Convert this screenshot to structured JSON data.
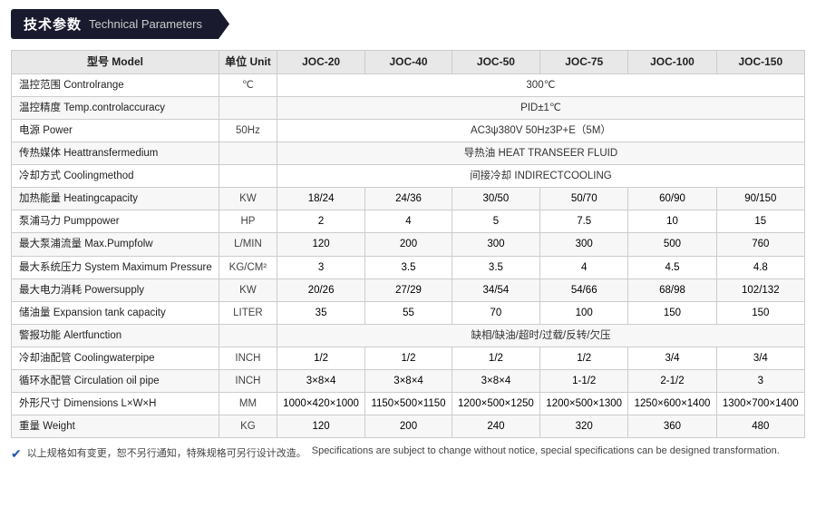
{
  "header": {
    "cn_title": "技术参数",
    "en_title": "Technical Parameters"
  },
  "table": {
    "columns": [
      "型号 Model",
      "单位 Unit",
      "JOC-20",
      "JOC-40",
      "JOC-50",
      "JOC-75",
      "JOC-100",
      "JOC-150"
    ],
    "rows": [
      {
        "label": "温控范围 Controlrange",
        "unit": "℃",
        "values": [
          "300℃",
          null,
          null,
          null,
          null,
          null
        ],
        "span": 6
      },
      {
        "label": "温控精度 Temp.controlaccuracy",
        "unit": "",
        "values": [
          "PID±1℃",
          null,
          null,
          null,
          null,
          null
        ],
        "span": 6
      },
      {
        "label": "电源 Power",
        "unit": "50Hz",
        "values": [
          "AC3ψ380V 50Hz3P+E（5M）",
          null,
          null,
          null,
          null,
          null
        ],
        "span": 6
      },
      {
        "label": "传热媒体 Heattransfermedium",
        "unit": "",
        "values": [
          "导热油 HEAT TRANSEER FLUID",
          null,
          null,
          null,
          null,
          null
        ],
        "span": 6
      },
      {
        "label": "冷却方式 Coolingmethod",
        "unit": "",
        "values": [
          "间接冷却 INDIRECTCOOLING",
          null,
          null,
          null,
          null,
          null
        ],
        "span": 6
      },
      {
        "label": "加热能量 Heatingcapacity",
        "unit": "KW",
        "values": [
          "18/24",
          "24/36",
          "30/50",
          "50/70",
          "60/90",
          "90/150"
        ],
        "span": null
      },
      {
        "label": "泵浦马力 Pumppower",
        "unit": "HP",
        "values": [
          "2",
          "4",
          "5",
          "7.5",
          "10",
          "15"
        ],
        "span": null
      },
      {
        "label": "最大泵浦流量 Max.Pumpfolw",
        "unit": "L/MIN",
        "values": [
          "120",
          "200",
          "300",
          "300",
          "500",
          "760"
        ],
        "span": null
      },
      {
        "label": "最大系统压力 System Maximum Pressure",
        "unit": "KG/CM²",
        "values": [
          "3",
          "3.5",
          "3.5",
          "4",
          "4.5",
          "4.8"
        ],
        "span": null
      },
      {
        "label": "最大电力消耗 Powersupply",
        "unit": "KW",
        "values": [
          "20/26",
          "27/29",
          "34/54",
          "54/66",
          "68/98",
          "102/132"
        ],
        "span": null
      },
      {
        "label": "储油量 Expansion tank capacity",
        "unit": "LITER",
        "values": [
          "35",
          "55",
          "70",
          "100",
          "150",
          "150"
        ],
        "span": null
      },
      {
        "label": "警报功能 Alertfunction",
        "unit": "",
        "values": [
          "缺相/缺油/超时/过载/反转/欠压",
          null,
          null,
          null,
          null,
          null
        ],
        "span": 6
      },
      {
        "label": "冷却油配管 Coolingwaterpipe",
        "unit": "INCH",
        "values": [
          "1/2",
          "1/2",
          "1/2",
          "1/2",
          "3/4",
          "3/4"
        ],
        "span": null
      },
      {
        "label": "循环水配管 Circulation oil pipe",
        "unit": "INCH",
        "values": [
          "3×8×4",
          "3×8×4",
          "3×8×4",
          "1-1/2",
          "2-1/2",
          "3"
        ],
        "span": null
      },
      {
        "label": "外形尺寸 Dimensions L×W×H",
        "unit": "MM",
        "values": [
          "1000×420×1000",
          "1150×500×1150",
          "1200×500×1250",
          "1200×500×1300",
          "1250×600×1400",
          "1300×700×1400"
        ],
        "span": null
      },
      {
        "label": "重量 Weight",
        "unit": "KG",
        "values": [
          "120",
          "200",
          "240",
          "320",
          "360",
          "480"
        ],
        "span": null
      }
    ]
  },
  "footer": {
    "icon": "✔",
    "cn_text": "以上规格如有变更，恕不另行通知，特殊规格可另行设计改造。",
    "en_text": "Specifications are subject to change without notice, special specifications can be designed transformation."
  }
}
